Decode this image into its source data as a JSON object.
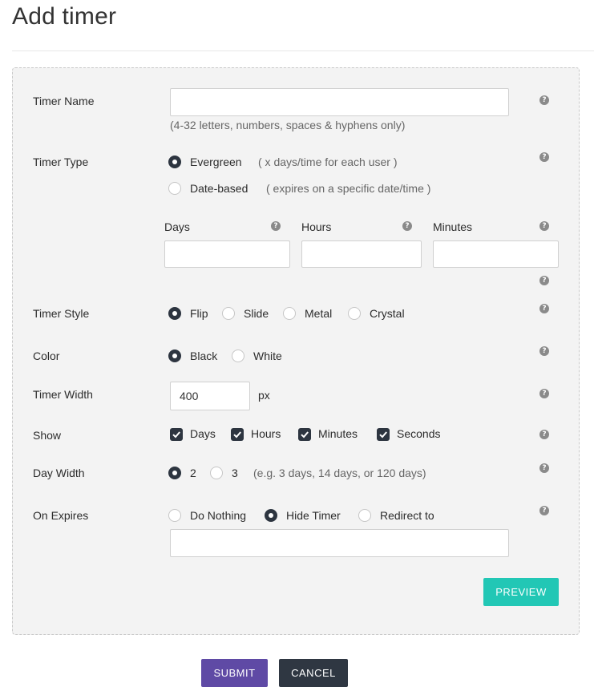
{
  "page": {
    "title": "Add timer"
  },
  "fields": {
    "timer_name": {
      "label": "Timer Name",
      "value": "",
      "hint": "(4-32 letters, numbers, spaces & hyphens only)"
    },
    "timer_type": {
      "label": "Timer Type",
      "options": [
        {
          "label": "Evergreen",
          "note": "( x days/time for each user )",
          "selected": true
        },
        {
          "label": "Date-based",
          "note": "( expires on a specific date/time )",
          "selected": false
        }
      ],
      "days_label": "Days",
      "days_value": "",
      "hours_label": "Hours",
      "hours_value": "",
      "minutes_label": "Minutes",
      "minutes_value": ""
    },
    "timer_style": {
      "label": "Timer Style",
      "options": [
        "Flip",
        "Slide",
        "Metal",
        "Crystal"
      ],
      "selected": "Flip"
    },
    "color": {
      "label": "Color",
      "options": [
        "Black",
        "White"
      ],
      "selected": "Black"
    },
    "timer_width": {
      "label": "Timer Width",
      "value": "400",
      "unit": "px"
    },
    "show": {
      "label": "Show",
      "options": [
        "Days",
        "Hours",
        "Minutes",
        "Seconds"
      ],
      "checked": [
        true,
        true,
        true,
        true
      ]
    },
    "day_width": {
      "label": "Day Width",
      "options": [
        "2",
        "3"
      ],
      "selected": "2",
      "hint": "(e.g. 3 days, 14 days, or 120 days)"
    },
    "on_expires": {
      "label": "On Expires",
      "options": [
        "Do Nothing",
        "Hide Timer",
        "Redirect to"
      ],
      "selected": "Hide Timer",
      "redirect_value": ""
    }
  },
  "buttons": {
    "preview": "PREVIEW",
    "submit": "SUBMIT",
    "cancel": "CANCEL"
  },
  "help_glyph": "?",
  "colors": {
    "accent_teal": "#22c7b5",
    "accent_purple": "#5f4aa5",
    "dark": "#2f3742",
    "panel_bg": "#f3f3f3"
  }
}
